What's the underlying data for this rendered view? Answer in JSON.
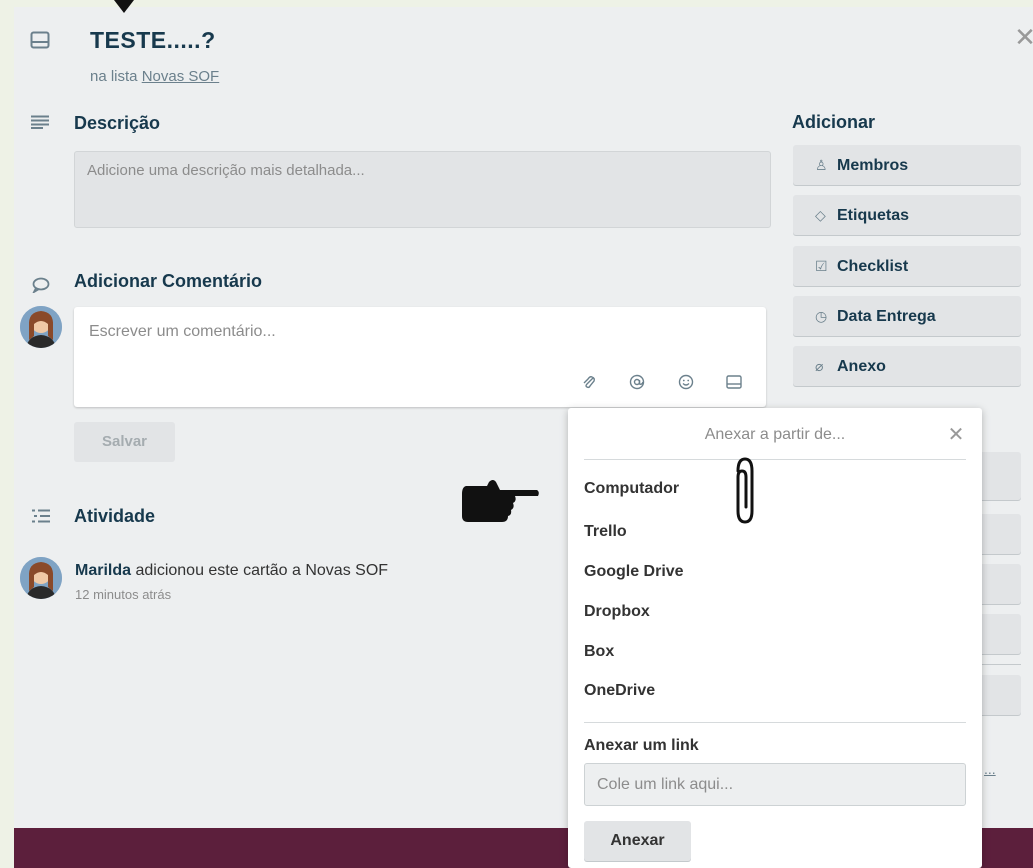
{
  "card": {
    "title": "TESTE.....?",
    "list_prefix": "na lista ",
    "list_name": "Novas SOF"
  },
  "description": {
    "heading": "Descrição",
    "placeholder": "Adicione uma descrição mais detalhada..."
  },
  "comment": {
    "heading": "Adicionar Comentário",
    "placeholder": "Escrever um comentário...",
    "save_label": "Salvar"
  },
  "activity": {
    "heading": "Atividade",
    "entries": [
      {
        "user": "Marilda",
        "text": " adicionou este cartão a Novas SOF",
        "time": "12 minutos atrás"
      }
    ]
  },
  "sidebar": {
    "heading": "Adicionar",
    "buttons": [
      {
        "icon": "person-icon",
        "label": "Membros"
      },
      {
        "icon": "tag-icon",
        "label": "Etiquetas"
      },
      {
        "icon": "checkbox-icon",
        "label": "Checklist"
      },
      {
        "icon": "clock-icon",
        "label": "Data Entrega"
      },
      {
        "icon": "paperclip-icon",
        "label": "Anexo"
      }
    ]
  },
  "popover": {
    "title": "Anexar a partir de...",
    "sources": [
      "Computador",
      "Trello",
      "Google Drive",
      "Dropbox",
      "Box",
      "OneDrive"
    ],
    "link_label": "Anexar um link",
    "link_placeholder": "Cole um link aqui...",
    "submit_label": "Anexar"
  },
  "colors": {
    "window_bg": "#edeff0",
    "heading": "#17394d",
    "muted": "#8c8c8c",
    "bottom_bar": "#5c1f3c"
  }
}
